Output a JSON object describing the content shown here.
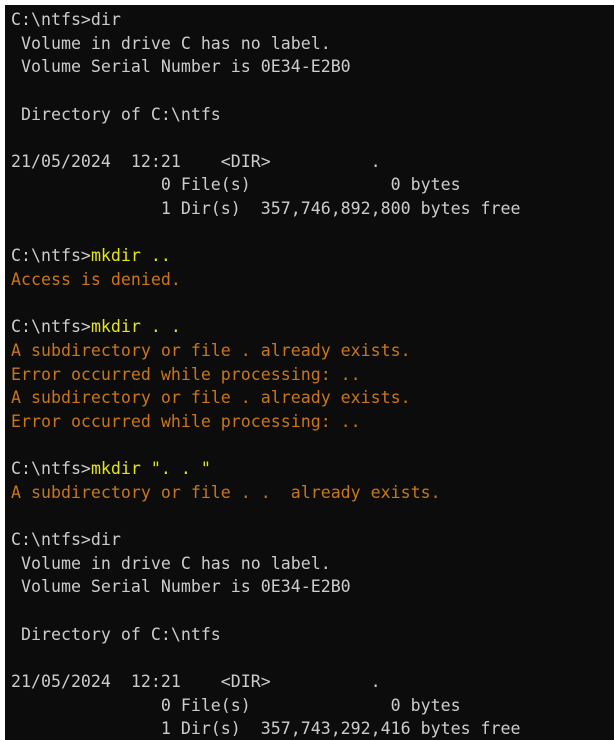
{
  "colors": {
    "background": "#0c0c0c",
    "output_text": "#cccccc",
    "command_text": "#e5e510",
    "error_text": "#c87619"
  },
  "lines": [
    [
      {
        "t": "C:\\ntfs>dir",
        "c": "out"
      }
    ],
    [
      {
        "t": " Volume in drive C has no label.",
        "c": "out"
      }
    ],
    [
      {
        "t": " Volume Serial Number is 0E34-E2B0",
        "c": "out"
      }
    ],
    [],
    [
      {
        "t": " Directory of C:\\ntfs",
        "c": "out"
      }
    ],
    [],
    [
      {
        "t": "21/05/2024  12:21    <DIR>          .",
        "c": "out"
      }
    ],
    [
      {
        "t": "               0 File(s)              0 bytes",
        "c": "out"
      }
    ],
    [
      {
        "t": "               1 Dir(s)  357,746,892,800 bytes free",
        "c": "out"
      }
    ],
    [],
    [
      {
        "t": "C:\\ntfs>",
        "c": "out"
      },
      {
        "t": "mkdir ..",
        "c": "cmd"
      }
    ],
    [
      {
        "t": "Access is denied.",
        "c": "err"
      }
    ],
    [],
    [
      {
        "t": "C:\\ntfs>",
        "c": "out"
      },
      {
        "t": "mkdir . .",
        "c": "cmd"
      }
    ],
    [
      {
        "t": "A subdirectory or file . already exists.",
        "c": "err"
      }
    ],
    [
      {
        "t": "Error occurred while processing: ..",
        "c": "err"
      }
    ],
    [
      {
        "t": "A subdirectory or file . already exists.",
        "c": "err"
      }
    ],
    [
      {
        "t": "Error occurred while processing: ..",
        "c": "err"
      }
    ],
    [],
    [
      {
        "t": "C:\\ntfs>",
        "c": "out"
      },
      {
        "t": "mkdir \". . \"",
        "c": "cmd"
      }
    ],
    [
      {
        "t": "A subdirectory or file . .  already exists.",
        "c": "err"
      }
    ],
    [],
    [
      {
        "t": "C:\\ntfs>dir",
        "c": "out"
      }
    ],
    [
      {
        "t": " Volume in drive C has no label.",
        "c": "out"
      }
    ],
    [
      {
        "t": " Volume Serial Number is 0E34-E2B0",
        "c": "out"
      }
    ],
    [],
    [
      {
        "t": " Directory of C:\\ntfs",
        "c": "out"
      }
    ],
    [],
    [
      {
        "t": "21/05/2024  12:21    <DIR>          .",
        "c": "out"
      }
    ],
    [
      {
        "t": "               0 File(s)              0 bytes",
        "c": "out"
      }
    ],
    [
      {
        "t": "               1 Dir(s)  357,743,292,416 bytes free",
        "c": "out"
      }
    ]
  ]
}
